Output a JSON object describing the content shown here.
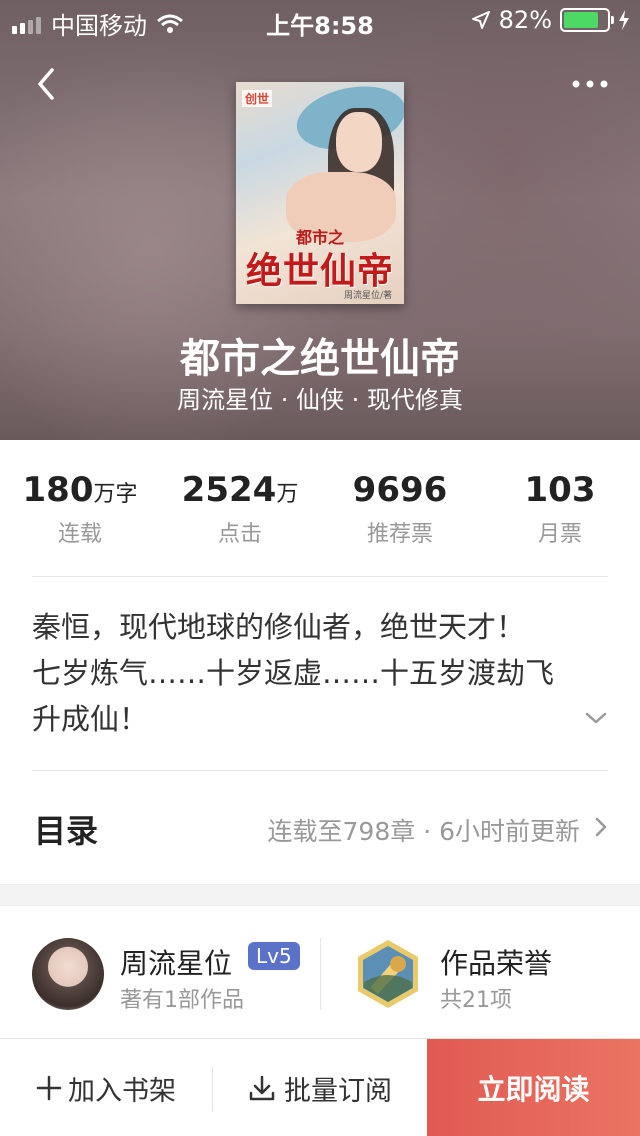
{
  "status_bar": {
    "carrier": "中国移动",
    "time": "上午8:58",
    "battery_percent": "82%",
    "battery_level": 0.82
  },
  "header": {
    "cover": {
      "logo": "创世",
      "title_small": "都市之",
      "title_big": "绝世仙帝",
      "author_mark": "周流星位/著"
    },
    "book_title": "都市之绝世仙帝",
    "meta": "周流星位 · 仙侠 · 现代修真"
  },
  "stats": [
    {
      "num": "180",
      "unit": "万字",
      "label": "连载"
    },
    {
      "num": "2524",
      "unit": "万",
      "label": "点击"
    },
    {
      "num": "9696",
      "unit": "",
      "label": "推荐票"
    },
    {
      "num": "103",
      "unit": "",
      "label": "月票"
    }
  ],
  "synopsis": {
    "lines": [
      "秦恒，现代地球的修仙者，绝世天才！",
      "七岁炼气……十岁返虚……十五岁渡劫飞",
      "升成仙！"
    ]
  },
  "catalog": {
    "label": "目录",
    "info": "连载至798章 · 6小时前更新"
  },
  "author": {
    "name": "周流星位",
    "level": "Lv5",
    "works": "著有1部作品"
  },
  "honor": {
    "title": "作品荣誉",
    "count": "共21项"
  },
  "bottom_bar": {
    "add_shelf": "加入书架",
    "batch_subscribe": "批量订阅",
    "read_now": "立即阅读"
  },
  "colors": {
    "read_button": "#e05a53",
    "level_badge": "#5b72c9",
    "battery": "#4cd964"
  }
}
